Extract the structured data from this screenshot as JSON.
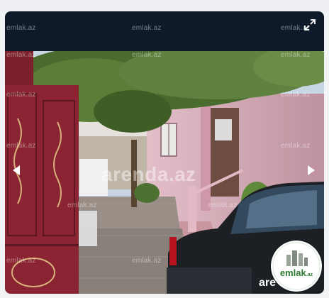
{
  "header": {
    "watermarks": [
      "emlak.az",
      "emlak.az",
      "emlak.az"
    ]
  },
  "gallery": {
    "photo_watermarks": [
      "emlak.az",
      "emlak.az",
      "emlak.az",
      "emlak.az",
      "emlak.az",
      "emlak.az",
      "emlak.az",
      "emlak.az",
      "emlak.az",
      "emlak.az",
      "emlak.az",
      "emlak.az"
    ],
    "center_watermark": "arenda.az",
    "bottom_brand": "are",
    "logo_text": "emlak",
    "logo_suffix": ".az"
  },
  "icons": {
    "expand": "expand-icon",
    "prev": "chevron-left-icon",
    "next": "chevron-right-icon"
  },
  "colors": {
    "viewer_bg": "#0e1a2a",
    "house_wall": "#d9a9b6",
    "gate": "#8a2432",
    "car": "#1c1f24",
    "foliage": "#4a6b2e",
    "logo_green": "#2e7d32"
  }
}
